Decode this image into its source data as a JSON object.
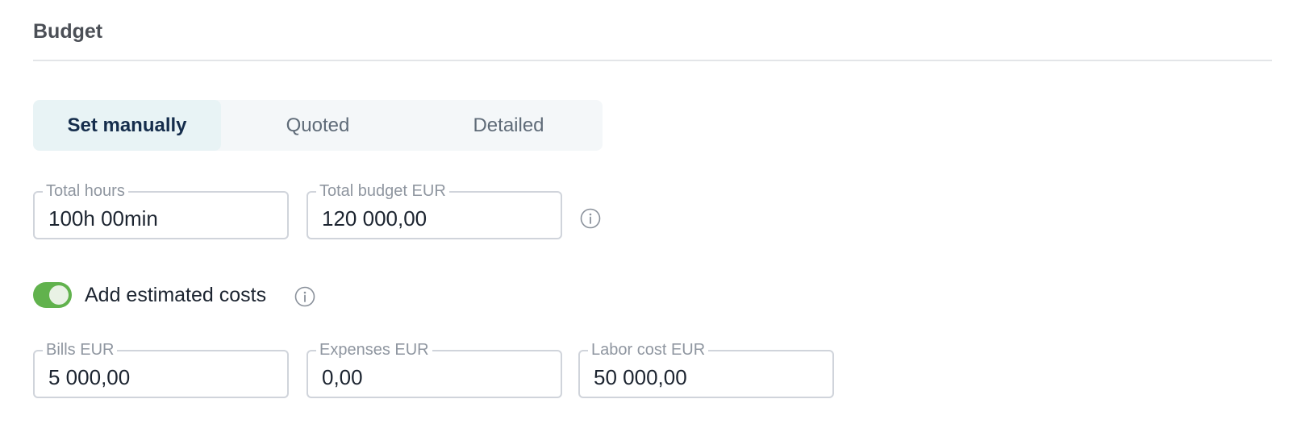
{
  "section": {
    "title": "Budget"
  },
  "budget_mode": {
    "options": [
      {
        "label": "Set manually",
        "active": true
      },
      {
        "label": "Quoted",
        "active": false
      },
      {
        "label": "Detailed",
        "active": false
      }
    ]
  },
  "totals": {
    "hours": {
      "label": "Total hours",
      "value": "100h 00min"
    },
    "budget": {
      "label": "Total budget EUR",
      "value": "120 000,00"
    },
    "info_icon": "info-icon"
  },
  "estimated_costs": {
    "toggle_on": true,
    "label": "Add estimated costs",
    "info_icon": "info-icon",
    "bills": {
      "label": "Bills EUR",
      "value": "5 000,00"
    },
    "expenses": {
      "label": "Expenses EUR",
      "value": "0,00"
    },
    "labor": {
      "label": "Labor cost EUR",
      "value": "50 000,00"
    }
  },
  "colors": {
    "toggle_on": "#61b24d",
    "active_tab_text": "#152d4c",
    "active_tab_bg": "#e8f3f5",
    "segment_bg": "#f4f7f9",
    "field_border": "#d0d4db"
  }
}
